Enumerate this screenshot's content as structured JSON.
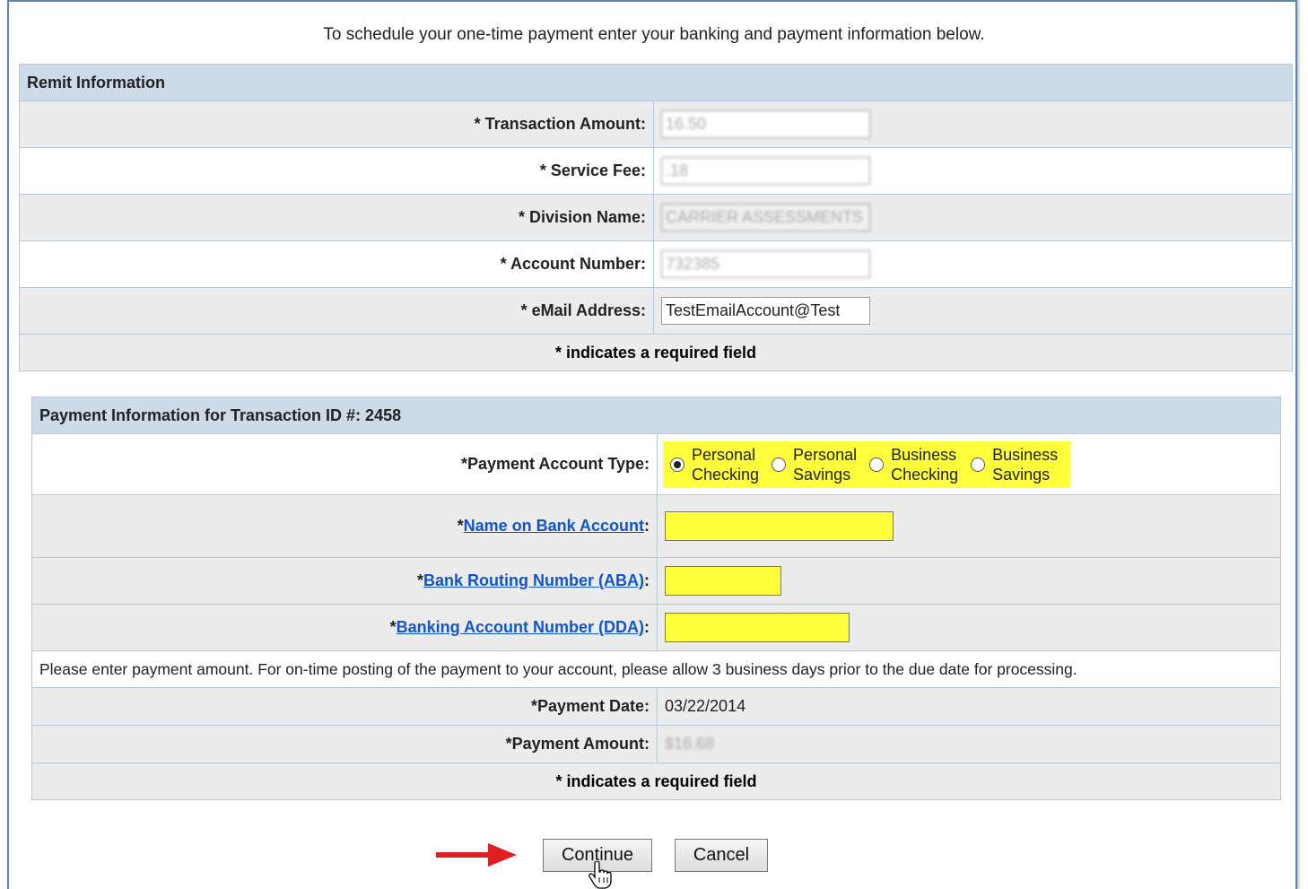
{
  "intro": "To schedule your one-time payment enter your banking and payment information below.",
  "remit": {
    "header": "Remit Information",
    "rows": [
      {
        "label": "* Transaction Amount:",
        "value": "16.50"
      },
      {
        "label": "* Service Fee:",
        "value": ".18"
      },
      {
        "label": "* Division Name:",
        "value": "CARRIER ASSESSMENTS"
      },
      {
        "label": "* Account Number:",
        "value": "732385"
      },
      {
        "label": "* eMail Address:",
        "value": "TestEmailAccount@Test"
      }
    ],
    "required_note": "* indicates a required field"
  },
  "payment": {
    "header": "Payment Information for Transaction ID #: 2458",
    "account_type_label": "*Payment Account Type:",
    "account_types": [
      {
        "line1": "Personal",
        "line2": "Checking",
        "selected": true
      },
      {
        "line1": "Personal",
        "line2": "Savings",
        "selected": false
      },
      {
        "line1": "Business",
        "line2": "Checking",
        "selected": false
      },
      {
        "line1": "Business",
        "line2": "Savings",
        "selected": false
      }
    ],
    "name_prefix": "*",
    "name_link": "Name on Bank Account",
    "routing_prefix": "*",
    "routing_link": "Bank Routing Number (ABA)",
    "account_prefix": "*",
    "account_link": "Banking Account Number (DDA)",
    "colon": ":",
    "note": "Please enter payment amount. For on-time posting of the payment to your account, please allow 3 business days prior to the due date for processing.",
    "date_label": "*Payment Date:",
    "date_value": "03/22/2014",
    "amount_label": "*Payment Amount:",
    "amount_value": "$16.68",
    "required_note": "* indicates a required field"
  },
  "buttons": {
    "continue": "Continue",
    "cancel": "Cancel"
  },
  "colors": {
    "header_bg": "#cddbe9",
    "highlight": "#ffff3c",
    "link": "#1155cc"
  }
}
